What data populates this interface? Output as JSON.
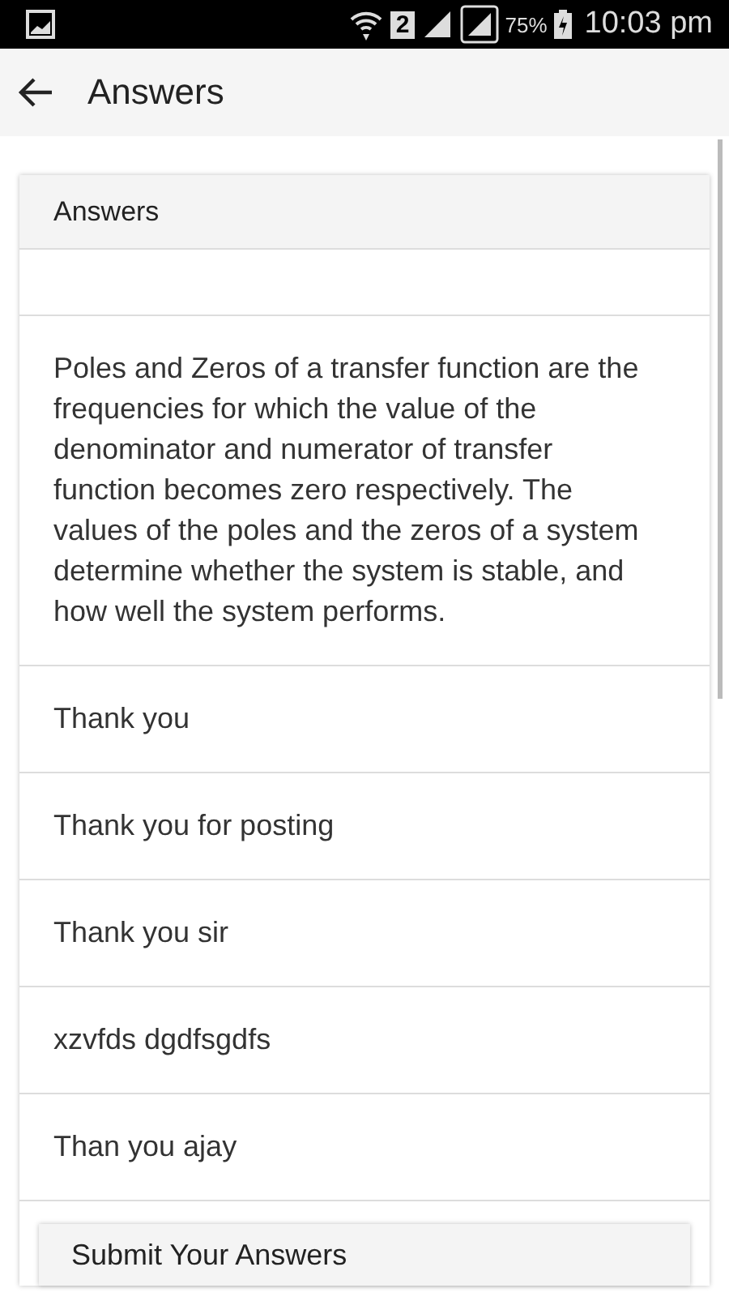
{
  "status_bar": {
    "sim": "2",
    "battery": "75%",
    "time": "10:03 pm"
  },
  "app_bar": {
    "title": "Answers"
  },
  "card": {
    "header": "Answers",
    "answers": [
      "Poles and Zeros of a transfer function are the frequencies for which the value of the denominator and numerator of transfer function becomes zero respectively. The values of the poles and the zeros of a system determine whether the system is stable, and how well the system performs.",
      "Thank you",
      "Thank you for posting",
      "Thank you sir",
      "xzvfds dgdfsgdfs",
      "Than you ajay"
    ],
    "submit_header": "Submit Your Answers"
  }
}
